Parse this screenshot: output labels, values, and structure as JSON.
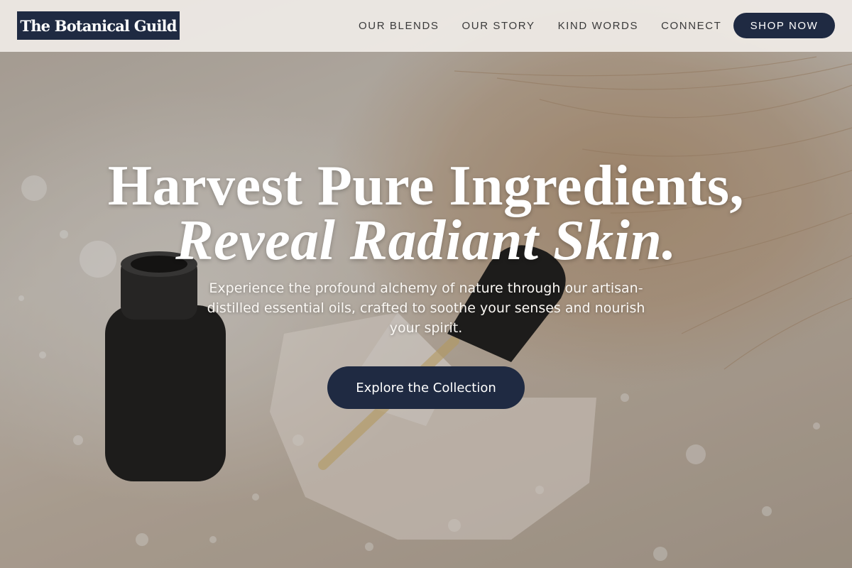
{
  "header": {
    "logo_text": "The Botanical Guild",
    "nav": [
      "OUR BLENDS",
      "OUR STORY",
      "KIND WORDS",
      "CONNECT"
    ],
    "cta_label": "SHOP NOW"
  },
  "hero": {
    "headline_line1": "Harvest Pure Ingredients,",
    "headline_line2": "Reveal Radiant Skin.",
    "subtext": "Experience the profound alchemy of nature through our artisan-distilled essential oils, crafted to soothe your senses and nourish your spirit.",
    "button_label": "Explore the Collection"
  },
  "colors": {
    "navy": "#1f2a42",
    "header_bg": "#f0ece7",
    "text_light": "#ffffff"
  }
}
